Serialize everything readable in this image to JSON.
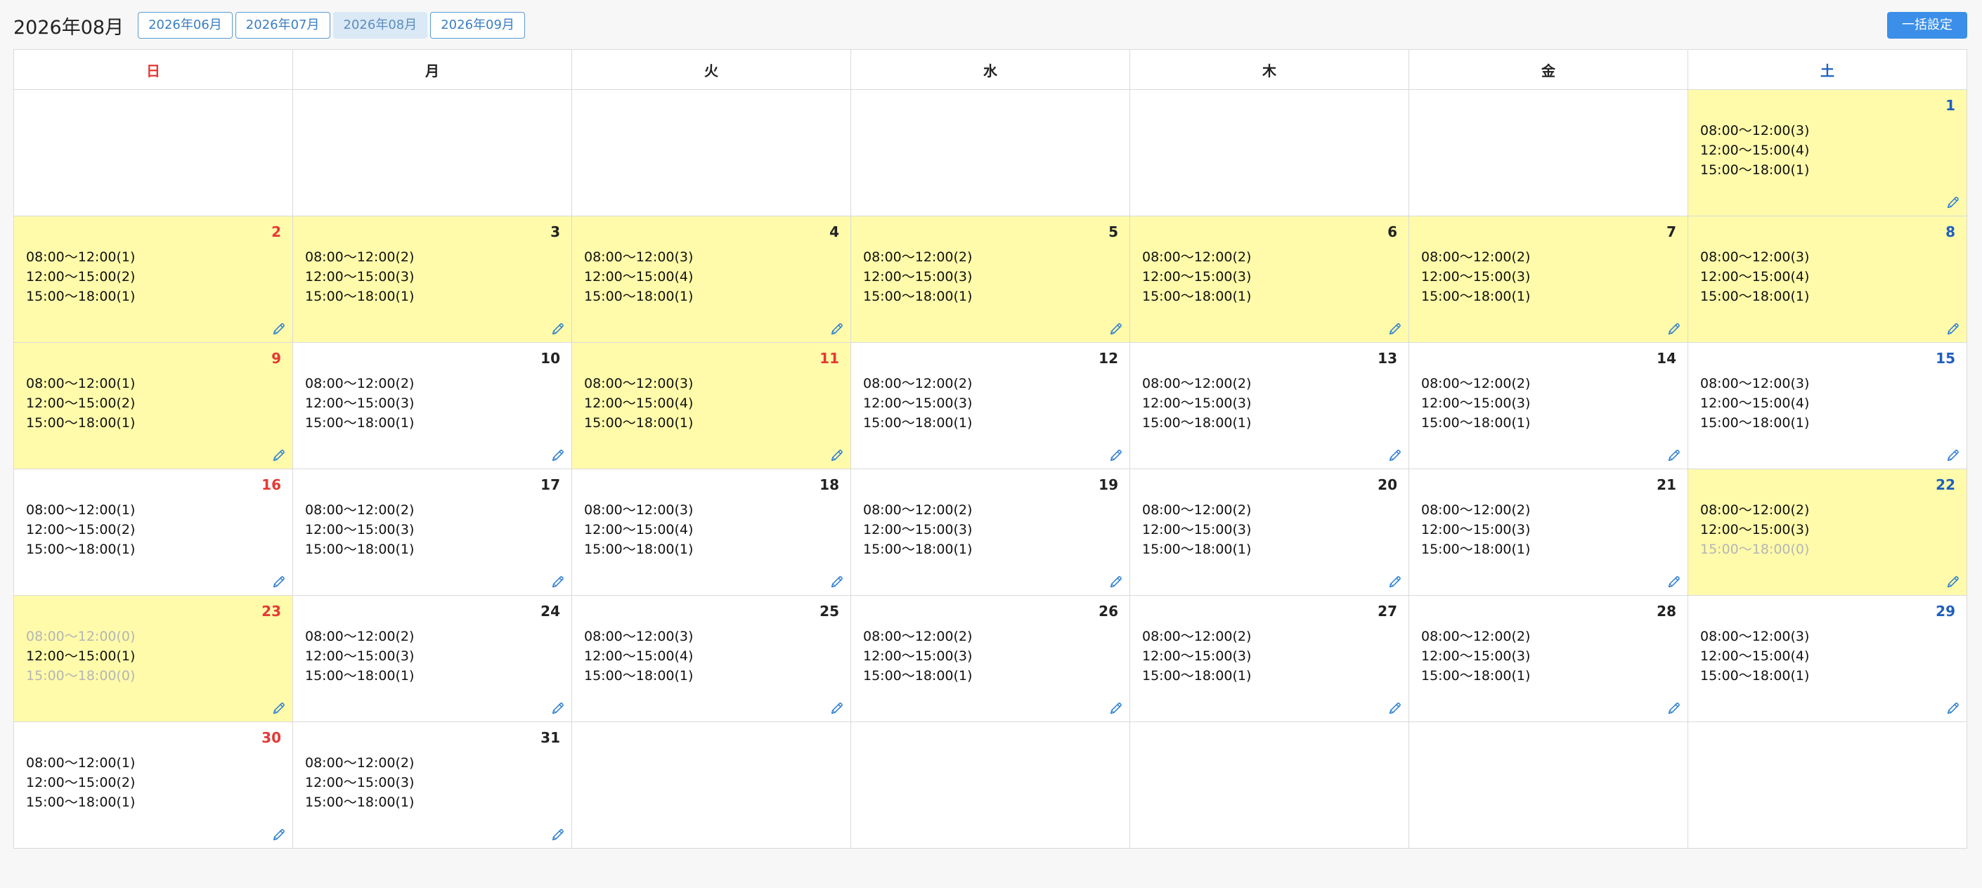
{
  "header": {
    "title": "2026年08月",
    "months": [
      {
        "label": "2026年06月",
        "active": false
      },
      {
        "label": "2026年07月",
        "active": false
      },
      {
        "label": "2026年08月",
        "active": true
      },
      {
        "label": "2026年09月",
        "active": false
      }
    ],
    "bulk_label": "一括設定"
  },
  "colors": {
    "highlight": "#fffbaa",
    "sunday": "#e53935",
    "saturday": "#1e5fbf",
    "accent": "#3b8fe8"
  },
  "weekdays": [
    "日",
    "月",
    "火",
    "水",
    "木",
    "金",
    "土"
  ],
  "weeks": [
    [
      null,
      null,
      null,
      null,
      null,
      null,
      {
        "day": "1",
        "hl": true,
        "slots": [
          {
            "text": "08:00〜12:00(3)",
            "c": 3
          },
          {
            "text": "12:00〜15:00(4)",
            "c": 4
          },
          {
            "text": "15:00〜18:00(1)",
            "c": 1
          }
        ]
      }
    ],
    [
      {
        "day": "2",
        "hl": true,
        "slots": [
          {
            "text": "08:00〜12:00(1)",
            "c": 1
          },
          {
            "text": "12:00〜15:00(2)",
            "c": 2
          },
          {
            "text": "15:00〜18:00(1)",
            "c": 1
          }
        ]
      },
      {
        "day": "3",
        "hl": true,
        "slots": [
          {
            "text": "08:00〜12:00(2)",
            "c": 2
          },
          {
            "text": "12:00〜15:00(3)",
            "c": 3
          },
          {
            "text": "15:00〜18:00(1)",
            "c": 1
          }
        ]
      },
      {
        "day": "4",
        "hl": true,
        "slots": [
          {
            "text": "08:00〜12:00(3)",
            "c": 3
          },
          {
            "text": "12:00〜15:00(4)",
            "c": 4
          },
          {
            "text": "15:00〜18:00(1)",
            "c": 1
          }
        ]
      },
      {
        "day": "5",
        "hl": true,
        "slots": [
          {
            "text": "08:00〜12:00(2)",
            "c": 2
          },
          {
            "text": "12:00〜15:00(3)",
            "c": 3
          },
          {
            "text": "15:00〜18:00(1)",
            "c": 1
          }
        ]
      },
      {
        "day": "6",
        "hl": true,
        "slots": [
          {
            "text": "08:00〜12:00(2)",
            "c": 2
          },
          {
            "text": "12:00〜15:00(3)",
            "c": 3
          },
          {
            "text": "15:00〜18:00(1)",
            "c": 1
          }
        ]
      },
      {
        "day": "7",
        "hl": true,
        "slots": [
          {
            "text": "08:00〜12:00(2)",
            "c": 2
          },
          {
            "text": "12:00〜15:00(3)",
            "c": 3
          },
          {
            "text": "15:00〜18:00(1)",
            "c": 1
          }
        ]
      },
      {
        "day": "8",
        "hl": true,
        "slots": [
          {
            "text": "08:00〜12:00(3)",
            "c": 3
          },
          {
            "text": "12:00〜15:00(4)",
            "c": 4
          },
          {
            "text": "15:00〜18:00(1)",
            "c": 1
          }
        ]
      }
    ],
    [
      {
        "day": "9",
        "hl": true,
        "slots": [
          {
            "text": "08:00〜12:00(1)",
            "c": 1
          },
          {
            "text": "12:00〜15:00(2)",
            "c": 2
          },
          {
            "text": "15:00〜18:00(1)",
            "c": 1
          }
        ]
      },
      {
        "day": "10",
        "hl": false,
        "slots": [
          {
            "text": "08:00〜12:00(2)",
            "c": 2
          },
          {
            "text": "12:00〜15:00(3)",
            "c": 3
          },
          {
            "text": "15:00〜18:00(1)",
            "c": 1
          }
        ]
      },
      {
        "day": "11",
        "hl": true,
        "holiday": true,
        "slots": [
          {
            "text": "08:00〜12:00(3)",
            "c": 3
          },
          {
            "text": "12:00〜15:00(4)",
            "c": 4
          },
          {
            "text": "15:00〜18:00(1)",
            "c": 1
          }
        ]
      },
      {
        "day": "12",
        "hl": false,
        "slots": [
          {
            "text": "08:00〜12:00(2)",
            "c": 2
          },
          {
            "text": "12:00〜15:00(3)",
            "c": 3
          },
          {
            "text": "15:00〜18:00(1)",
            "c": 1
          }
        ]
      },
      {
        "day": "13",
        "hl": false,
        "slots": [
          {
            "text": "08:00〜12:00(2)",
            "c": 2
          },
          {
            "text": "12:00〜15:00(3)",
            "c": 3
          },
          {
            "text": "15:00〜18:00(1)",
            "c": 1
          }
        ]
      },
      {
        "day": "14",
        "hl": false,
        "slots": [
          {
            "text": "08:00〜12:00(2)",
            "c": 2
          },
          {
            "text": "12:00〜15:00(3)",
            "c": 3
          },
          {
            "text": "15:00〜18:00(1)",
            "c": 1
          }
        ]
      },
      {
        "day": "15",
        "hl": false,
        "slots": [
          {
            "text": "08:00〜12:00(3)",
            "c": 3
          },
          {
            "text": "12:00〜15:00(4)",
            "c": 4
          },
          {
            "text": "15:00〜18:00(1)",
            "c": 1
          }
        ]
      }
    ],
    [
      {
        "day": "16",
        "hl": false,
        "slots": [
          {
            "text": "08:00〜12:00(1)",
            "c": 1
          },
          {
            "text": "12:00〜15:00(2)",
            "c": 2
          },
          {
            "text": "15:00〜18:00(1)",
            "c": 1
          }
        ]
      },
      {
        "day": "17",
        "hl": false,
        "slots": [
          {
            "text": "08:00〜12:00(2)",
            "c": 2
          },
          {
            "text": "12:00〜15:00(3)",
            "c": 3
          },
          {
            "text": "15:00〜18:00(1)",
            "c": 1
          }
        ]
      },
      {
        "day": "18",
        "hl": false,
        "slots": [
          {
            "text": "08:00〜12:00(3)",
            "c": 3
          },
          {
            "text": "12:00〜15:00(4)",
            "c": 4
          },
          {
            "text": "15:00〜18:00(1)",
            "c": 1
          }
        ]
      },
      {
        "day": "19",
        "hl": false,
        "slots": [
          {
            "text": "08:00〜12:00(2)",
            "c": 2
          },
          {
            "text": "12:00〜15:00(3)",
            "c": 3
          },
          {
            "text": "15:00〜18:00(1)",
            "c": 1
          }
        ]
      },
      {
        "day": "20",
        "hl": false,
        "slots": [
          {
            "text": "08:00〜12:00(2)",
            "c": 2
          },
          {
            "text": "12:00〜15:00(3)",
            "c": 3
          },
          {
            "text": "15:00〜18:00(1)",
            "c": 1
          }
        ]
      },
      {
        "day": "21",
        "hl": false,
        "slots": [
          {
            "text": "08:00〜12:00(2)",
            "c": 2
          },
          {
            "text": "12:00〜15:00(3)",
            "c": 3
          },
          {
            "text": "15:00〜18:00(1)",
            "c": 1
          }
        ]
      },
      {
        "day": "22",
        "hl": true,
        "slots": [
          {
            "text": "08:00〜12:00(2)",
            "c": 2
          },
          {
            "text": "12:00〜15:00(3)",
            "c": 3
          },
          {
            "text": "15:00〜18:00(0)",
            "c": 0
          }
        ]
      }
    ],
    [
      {
        "day": "23",
        "hl": true,
        "slots": [
          {
            "text": "08:00〜12:00(0)",
            "c": 0
          },
          {
            "text": "12:00〜15:00(1)",
            "c": 1
          },
          {
            "text": "15:00〜18:00(0)",
            "c": 0
          }
        ]
      },
      {
        "day": "24",
        "hl": false,
        "slots": [
          {
            "text": "08:00〜12:00(2)",
            "c": 2
          },
          {
            "text": "12:00〜15:00(3)",
            "c": 3
          },
          {
            "text": "15:00〜18:00(1)",
            "c": 1
          }
        ]
      },
      {
        "day": "25",
        "hl": false,
        "slots": [
          {
            "text": "08:00〜12:00(3)",
            "c": 3
          },
          {
            "text": "12:00〜15:00(4)",
            "c": 4
          },
          {
            "text": "15:00〜18:00(1)",
            "c": 1
          }
        ]
      },
      {
        "day": "26",
        "hl": false,
        "slots": [
          {
            "text": "08:00〜12:00(2)",
            "c": 2
          },
          {
            "text": "12:00〜15:00(3)",
            "c": 3
          },
          {
            "text": "15:00〜18:00(1)",
            "c": 1
          }
        ]
      },
      {
        "day": "27",
        "hl": false,
        "slots": [
          {
            "text": "08:00〜12:00(2)",
            "c": 2
          },
          {
            "text": "12:00〜15:00(3)",
            "c": 3
          },
          {
            "text": "15:00〜18:00(1)",
            "c": 1
          }
        ]
      },
      {
        "day": "28",
        "hl": false,
        "slots": [
          {
            "text": "08:00〜12:00(2)",
            "c": 2
          },
          {
            "text": "12:00〜15:00(3)",
            "c": 3
          },
          {
            "text": "15:00〜18:00(1)",
            "c": 1
          }
        ]
      },
      {
        "day": "29",
        "hl": false,
        "slots": [
          {
            "text": "08:00〜12:00(3)",
            "c": 3
          },
          {
            "text": "12:00〜15:00(4)",
            "c": 4
          },
          {
            "text": "15:00〜18:00(1)",
            "c": 1
          }
        ]
      }
    ],
    [
      {
        "day": "30",
        "hl": false,
        "slots": [
          {
            "text": "08:00〜12:00(1)",
            "c": 1
          },
          {
            "text": "12:00〜15:00(2)",
            "c": 2
          },
          {
            "text": "15:00〜18:00(1)",
            "c": 1
          }
        ]
      },
      {
        "day": "31",
        "hl": false,
        "slots": [
          {
            "text": "08:00〜12:00(2)",
            "c": 2
          },
          {
            "text": "12:00〜15:00(3)",
            "c": 3
          },
          {
            "text": "15:00〜18:00(1)",
            "c": 1
          }
        ]
      },
      null,
      null,
      null,
      null,
      null
    ]
  ]
}
